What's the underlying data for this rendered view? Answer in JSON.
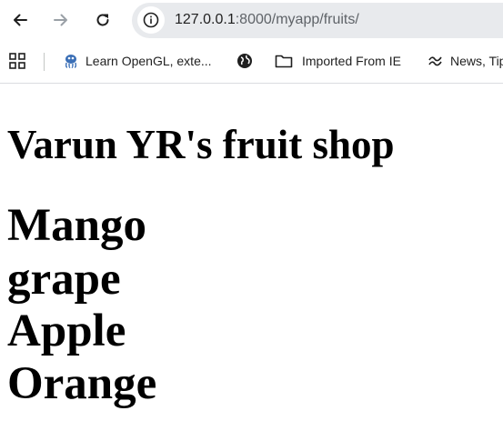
{
  "browser": {
    "address_bar": {
      "host": "127.0.0.1",
      "path": ":8000/myapp/fruits/"
    },
    "bookmarks": [
      {
        "label": "Learn OpenGL, exte...",
        "icon": "opengl-icon"
      },
      {
        "label": "",
        "icon": "globe-icon"
      },
      {
        "label": "Imported From IE",
        "icon": "folder-icon"
      },
      {
        "label": "News, Tip",
        "icon": "news-icon"
      }
    ]
  },
  "page": {
    "title": "Varun YR's fruit shop",
    "fruits": [
      "Mango",
      "grape",
      "Apple",
      "Orange"
    ]
  }
}
